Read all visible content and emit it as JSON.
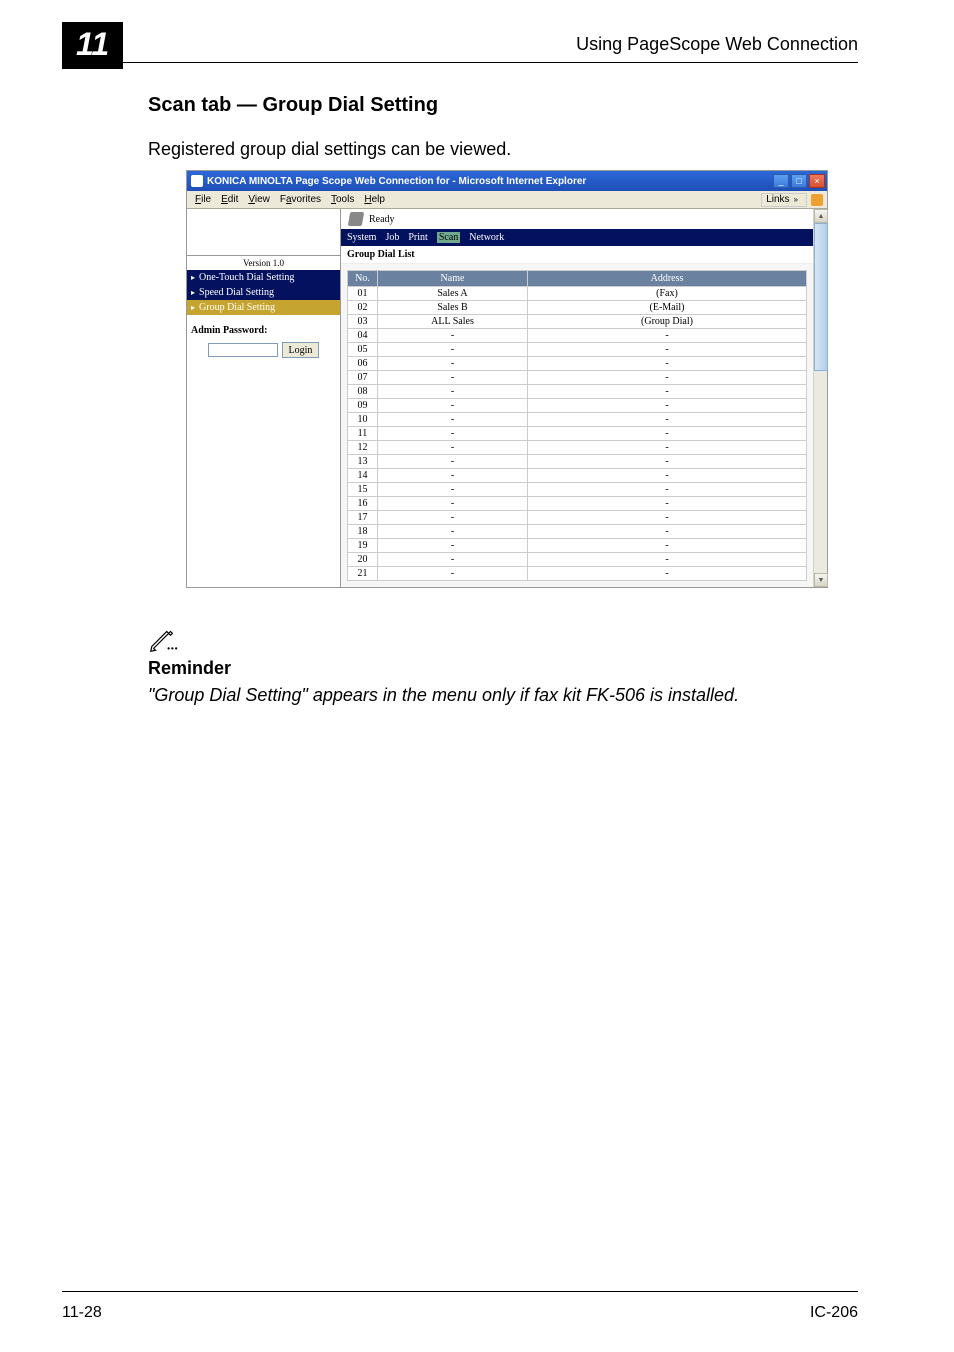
{
  "header": {
    "chapter": "11",
    "title": "Using PageScope Web Connection"
  },
  "section": {
    "heading": "Scan tab — Group Dial Setting",
    "intro": "Registered group dial settings can be viewed."
  },
  "ie": {
    "window_title": "KONICA MINOLTA Page Scope Web Connection for         - Microsoft Internet Explorer",
    "menu": {
      "file": "File",
      "edit": "Edit",
      "view": "View",
      "favorites": "Favorites",
      "tools": "Tools",
      "help": "Help",
      "links": "Links"
    },
    "left": {
      "version": "Version 1.0",
      "nav_one_touch": "One-Touch Dial Setting",
      "nav_speed": "Speed Dial Setting",
      "nav_group": "Group Dial Setting",
      "admin_label": "Admin Password:",
      "login_label": "Login"
    },
    "right": {
      "ready": "Ready",
      "tabs": {
        "system": "System",
        "job": "Job",
        "print": "Print",
        "scan": "Scan",
        "network": "Network"
      },
      "pane_title": "Group Dial List",
      "table": {
        "head_no": "No.",
        "head_name": "Name",
        "head_address": "Address",
        "rows": [
          {
            "no": "01",
            "name": "Sales A",
            "addr": "(Fax)"
          },
          {
            "no": "02",
            "name": "Sales B",
            "addr": "(E-Mail)"
          },
          {
            "no": "03",
            "name": "ALL Sales",
            "addr": "(Group Dial)"
          },
          {
            "no": "04",
            "name": "-",
            "addr": "-"
          },
          {
            "no": "05",
            "name": "-",
            "addr": "-"
          },
          {
            "no": "06",
            "name": "-",
            "addr": "-"
          },
          {
            "no": "07",
            "name": "-",
            "addr": "-"
          },
          {
            "no": "08",
            "name": "-",
            "addr": "-"
          },
          {
            "no": "09",
            "name": "-",
            "addr": "-"
          },
          {
            "no": "10",
            "name": "-",
            "addr": "-"
          },
          {
            "no": "11",
            "name": "-",
            "addr": "-"
          },
          {
            "no": "12",
            "name": "-",
            "addr": "-"
          },
          {
            "no": "13",
            "name": "-",
            "addr": "-"
          },
          {
            "no": "14",
            "name": "-",
            "addr": "-"
          },
          {
            "no": "15",
            "name": "-",
            "addr": "-"
          },
          {
            "no": "16",
            "name": "-",
            "addr": "-"
          },
          {
            "no": "17",
            "name": "-",
            "addr": "-"
          },
          {
            "no": "18",
            "name": "-",
            "addr": "-"
          },
          {
            "no": "19",
            "name": "-",
            "addr": "-"
          },
          {
            "no": "20",
            "name": "-",
            "addr": "-"
          },
          {
            "no": "21",
            "name": "-",
            "addr": "-"
          }
        ]
      }
    }
  },
  "reminder": {
    "heading": "Reminder",
    "text": "\"Group Dial Setting\" appears in the menu only if fax kit FK-506 is installed."
  },
  "footer": {
    "left": "11-28",
    "right": "IC-206"
  }
}
